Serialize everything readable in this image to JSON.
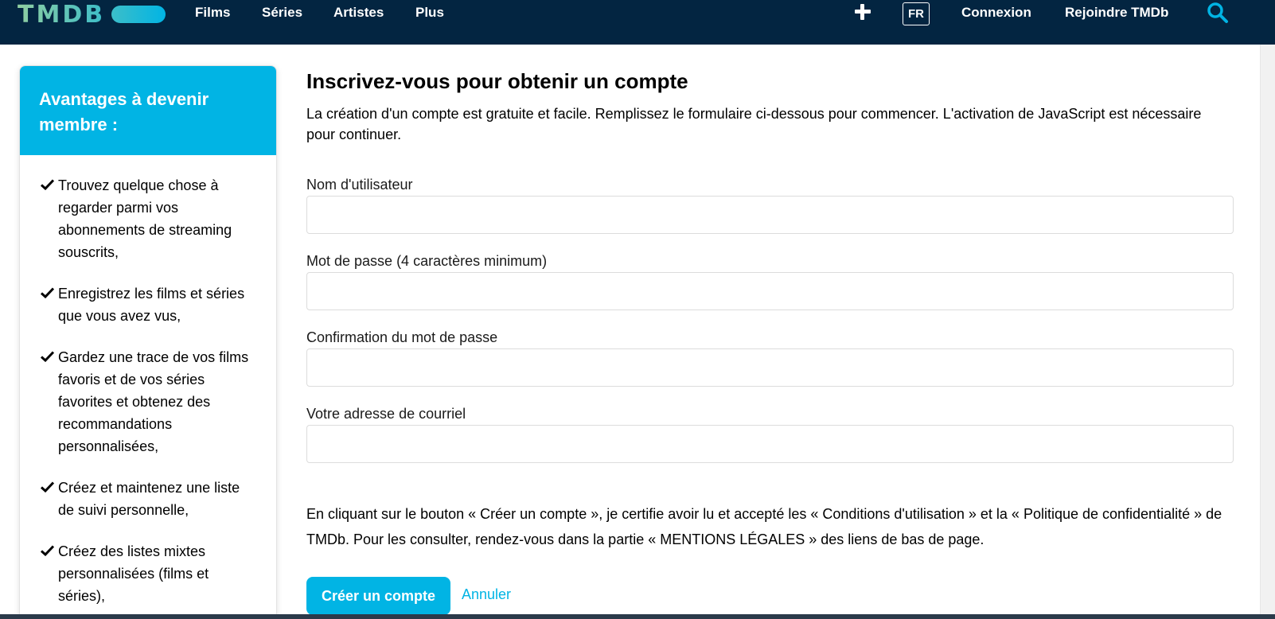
{
  "header": {
    "logo": "TMDB",
    "nav": [
      "Films",
      "Séries",
      "Artistes",
      "Plus"
    ],
    "language": "FR",
    "login": "Connexion",
    "join": "Rejoindre TMDb",
    "icons": {
      "add": "plus-icon",
      "search": "search-icon"
    }
  },
  "sidebar": {
    "title": "Avantages à devenir membre :",
    "items": [
      "Trouvez quelque chose à regarder parmi vos abonnements de streaming souscrits,",
      "Enregistrez les films et séries que vous avez vus,",
      "Gardez une trace de vos films favoris et de vos séries favorites et obtenez des recommandations personnalisées,",
      "Créez et maintenez une liste de suivi personnelle,",
      "Créez des listes mixtes personnalisées (films et séries),"
    ]
  },
  "main": {
    "title": "Inscrivez-vous pour obtenir un compte",
    "intro": "La création d'un compte est gratuite et facile. Remplissez le formulaire ci-dessous pour commencer. L'activation de JavaScript est nécessaire pour continuer.",
    "fields": [
      {
        "label": "Nom d'utilisateur",
        "value": ""
      },
      {
        "label": "Mot de passe (4 caractères minimum)",
        "value": ""
      },
      {
        "label": "Confirmation du mot de passe",
        "value": ""
      },
      {
        "label": "Votre adresse de courriel",
        "value": ""
      }
    ],
    "legal": "En cliquant sur le bouton « Créer un compte », je certifie avoir lu et accepté les « Conditions d'utilisation » et la « Politique de confidentialité » de TMDb. Pour les consulter, rendez-vous dans la partie « MENTIONS LÉGALES » des liens de bas de page.",
    "submit": "Créer un compte",
    "cancel": "Annuler"
  },
  "colors": {
    "header_bg": "#032541",
    "accent": "#01b4e4",
    "logo_gradient_start": "#90cea1",
    "logo_gradient_end": "#01b4e4"
  }
}
